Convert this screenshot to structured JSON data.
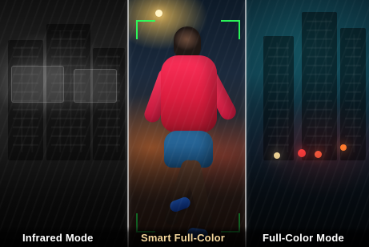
{
  "labels": {
    "left": "Infrared Mode",
    "center": "Smart Full-Color",
    "right": "Full-Color Mode"
  },
  "colors": {
    "focus_bracket": "#2bff5b",
    "center_label": "#f4d59b",
    "label": "#ffffff"
  },
  "icons": {
    "focus_frame": "focus-frame-corners"
  }
}
